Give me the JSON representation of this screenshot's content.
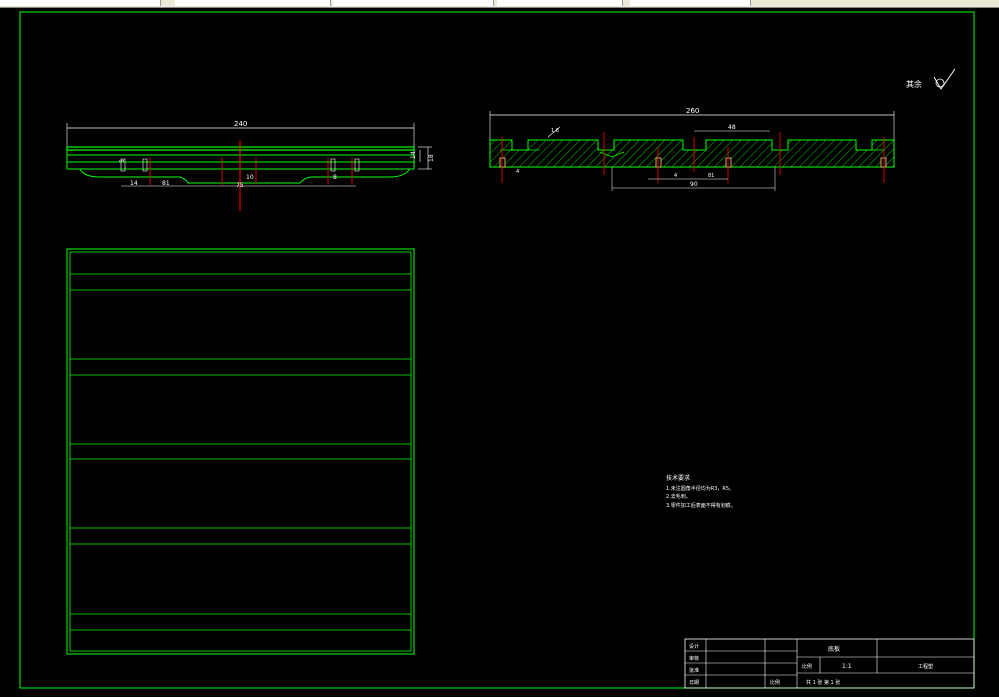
{
  "colors": {
    "background": "#000000",
    "frame": "#00ff00",
    "dimension": "#ffffff",
    "centerline": "#ff0000",
    "hatch": "#00ff00"
  },
  "front_view": {
    "overall_length": "240",
    "height_total": "18",
    "height_step": "14",
    "height_inner": "5",
    "dim_a": "14",
    "dim_b": "81",
    "dim_c": "10",
    "dim_d": "75",
    "dim_e": "8"
  },
  "section_view": {
    "overall_length": "260",
    "top_dim": "48",
    "bottom_dim": "90",
    "dim_left_small": "4",
    "dim_center_small": "4",
    "dim_center_right": "81",
    "roughness_label": "1.6"
  },
  "roughness_note": {
    "label": "其余",
    "symbol": "✓"
  },
  "notes": {
    "title": "技术要求",
    "lines": [
      "1.未注圆角半径均为R3，R5。",
      "2.去毛刺。",
      "3.零件加工后表面不得有划痕。"
    ]
  },
  "title_block": {
    "design_label": "设计",
    "check_label": "审核",
    "approve_label": "批准",
    "date_label": "日期",
    "name_label": "比例",
    "part_name": "底板",
    "scale_label": "比例",
    "scale_value": "1:1",
    "material": "工程塑",
    "sheet_text": "共 1 张   第 1 张"
  }
}
